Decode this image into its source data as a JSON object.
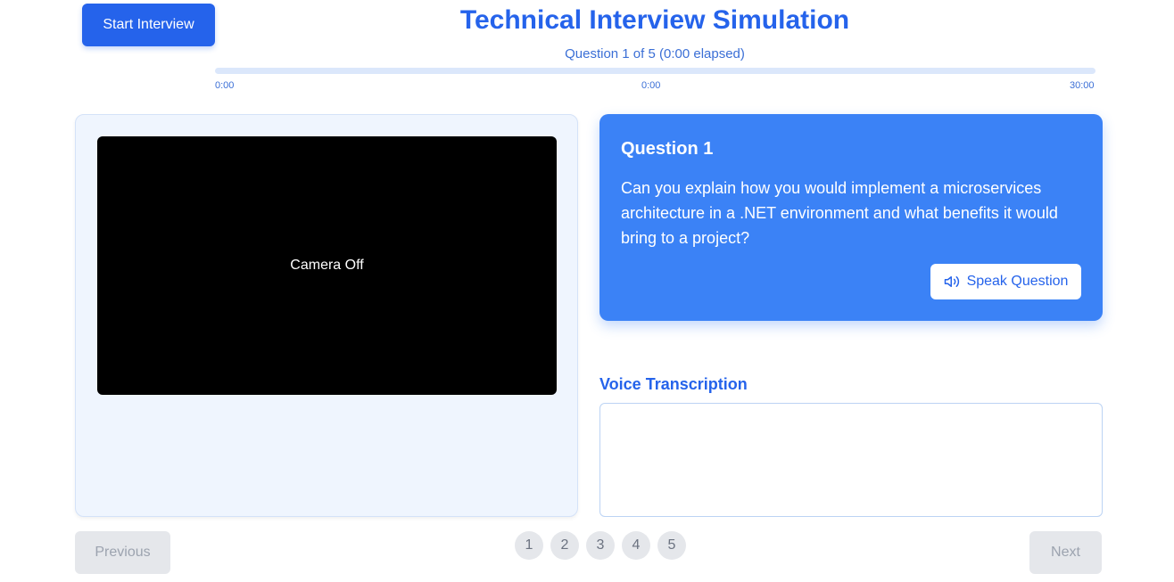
{
  "header": {
    "start_label": "Start Interview",
    "title": "Technical Interview Simulation",
    "progress_label": "Question 1 of 5 (0:00 elapsed)",
    "timer": {
      "progress": 0,
      "tick_start": "0:00",
      "tick_mid": "0:00",
      "tick_end": "30:00"
    }
  },
  "video": {
    "camera_text": "Camera Off"
  },
  "question": {
    "title": "Question 1",
    "text": "Can you explain how you would implement a microservices architecture in a .NET environment and what benefits it would bring to a project?",
    "speak_label": "Speak Question",
    "speak_icon": "speaker-icon"
  },
  "transcription": {
    "label": "Voice Transcription",
    "value": ""
  },
  "nav": {
    "previous_label": "Previous",
    "next_label": "Next",
    "pages": [
      "1",
      "2",
      "3",
      "4",
      "5"
    ]
  },
  "colors": {
    "primary": "#2563eb",
    "card": "#3b82f6",
    "panel_bg": "#eff5fe",
    "disabled_bg": "#e5e7eb",
    "disabled_text": "#9ca3af"
  }
}
